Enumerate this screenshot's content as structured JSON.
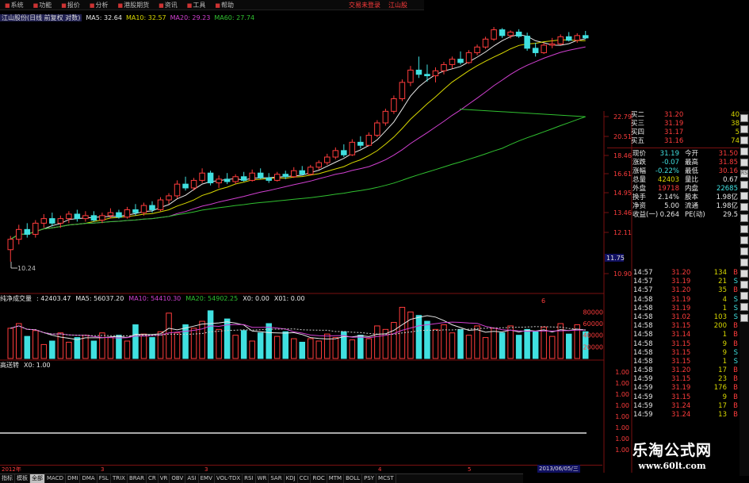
{
  "menu": {
    "items": [
      {
        "label": "系统",
        "icon": "menu-icon"
      },
      {
        "label": "功能",
        "icon": "menu-icon"
      },
      {
        "label": "报价",
        "icon": "menu-icon"
      },
      {
        "label": "分析",
        "icon": "menu-icon"
      },
      {
        "label": "港股期货",
        "icon": "menu-icon"
      },
      {
        "label": "资讯",
        "icon": "menu-icon"
      },
      {
        "label": "工具",
        "icon": "menu-icon"
      },
      {
        "label": "帮助",
        "icon": "menu-icon"
      }
    ],
    "right": [
      "交易未登录",
      "江山股"
    ]
  },
  "chart_header": {
    "stock_title": "江山股份(日线 前复权 对数)",
    "ma5": "MA5: 32.64",
    "ma10": "MA10: 32.57",
    "ma20": "MA20: 29.23",
    "ma60": "MA60: 27.74",
    "arrow": "↓"
  },
  "price_axis": {
    "labels": [
      "22.79",
      "20.51",
      "18.46",
      "16.61",
      "14.95",
      "13.46",
      "12.11",
      "10.90"
    ],
    "current": "11.75",
    "low_marker": "10.24"
  },
  "indicator1": {
    "name": "纯净成交量",
    "value": ": 42403.47",
    "ma5": "MA5: 56037.20",
    "ma10": "MA10: 54410.30",
    "ma20": "MA20: 54902.25",
    "x0": "X0: 0.00",
    "x01": "X01: 0.00",
    "axis": [
      "80000",
      "60000",
      "40000",
      "20000"
    ],
    "marker": "6"
  },
  "indicator2": {
    "name": "高送转",
    "x0": "X0: 1.00",
    "axis": [
      "1.00",
      "1.00",
      "1.00",
      "1.00",
      "1.00",
      "1.00",
      "1.00",
      "1.00"
    ]
  },
  "quote": {
    "bids": [
      {
        "label": "买二",
        "price": "31.20",
        "vol": "40"
      },
      {
        "label": "买三",
        "price": "31.19",
        "vol": "38"
      },
      {
        "label": "买四",
        "price": "31.17",
        "vol": "5"
      },
      {
        "label": "买五",
        "price": "31.16",
        "vol": "74"
      }
    ],
    "stats": [
      {
        "l1": "现价",
        "v1": "31.19",
        "l2": "今开",
        "v2": "31.50"
      },
      {
        "l1": "涨跌",
        "v1": "-0.07",
        "l2": "最高",
        "v2": "31.85"
      },
      {
        "l1": "涨幅",
        "v1": "-0.22%",
        "l2": "最低",
        "v2": "30.16"
      },
      {
        "l1": "总量",
        "v1": "42403",
        "l2": "量比",
        "v2": "0.67"
      },
      {
        "l1": "外盘",
        "v1": "19718",
        "l2": "内盘",
        "v2": "22685"
      },
      {
        "l1": "换手",
        "v1": "2.14%",
        "l2": "股本",
        "v2": "1.98亿"
      },
      {
        "l1": "净资",
        "v1": "5.00",
        "l2": "流通",
        "v2": "1.98亿"
      },
      {
        "l1": "收益(一)",
        "v1": "0.264",
        "l2": "PE(动)",
        "v2": "29.5"
      }
    ]
  },
  "ticks": [
    {
      "time": "14:57",
      "price": "31.20",
      "vol": "134",
      "flag": "B"
    },
    {
      "time": "14:57",
      "price": "31.19",
      "vol": "21",
      "flag": "S"
    },
    {
      "time": "14:57",
      "price": "31.20",
      "vol": "35",
      "flag": "B"
    },
    {
      "time": "14:58",
      "price": "31.19",
      "vol": "4",
      "flag": "S"
    },
    {
      "time": "14:58",
      "price": "31.19",
      "vol": "1",
      "flag": "S"
    },
    {
      "time": "14:58",
      "price": "31.02",
      "vol": "103",
      "flag": "S"
    },
    {
      "time": "14:58",
      "price": "31.15",
      "vol": "200",
      "flag": "B"
    },
    {
      "time": "14:58",
      "price": "31.14",
      "vol": "1",
      "flag": "B"
    },
    {
      "time": "14:58",
      "price": "31.15",
      "vol": "9",
      "flag": "B"
    },
    {
      "time": "14:58",
      "price": "31.15",
      "vol": "9",
      "flag": "S"
    },
    {
      "time": "14:58",
      "price": "31.15",
      "vol": "1",
      "flag": "S"
    },
    {
      "time": "14:58",
      "price": "31.20",
      "vol": "17",
      "flag": "B"
    },
    {
      "time": "14:59",
      "price": "31.15",
      "vol": "23",
      "flag": "B"
    },
    {
      "time": "14:59",
      "price": "31.19",
      "vol": "176",
      "flag": "B"
    },
    {
      "time": "14:59",
      "price": "31.15",
      "vol": "9",
      "flag": "B"
    },
    {
      "time": "14:59",
      "price": "31.24",
      "vol": "17",
      "flag": "B"
    },
    {
      "time": "14:59",
      "price": "31.24",
      "vol": "13",
      "flag": "B"
    }
  ],
  "time_axis": {
    "labels": [
      "2012年",
      "3",
      "3",
      "4",
      "5"
    ],
    "date": "2013/06/05/三"
  },
  "bottom_tabs": [
    "模板",
    "全部",
    "MACD",
    "DMI",
    "DMA",
    "FSL",
    "TRIX",
    "BRAR",
    "CR",
    "VR",
    "OBV",
    "ASI",
    "EMV",
    "VOL-TDX",
    "RSI",
    "WR",
    "SAR",
    "KDJ",
    "CCI",
    "ROC",
    "MTM",
    "BOLL",
    "PSY",
    "MCST"
  ],
  "bottom_left": "指标",
  "right_tools": [
    "rtool",
    "rtool",
    "rtool",
    "rtool",
    "rtool",
    "RSI",
    "rtool",
    "rtool",
    "rtool",
    "rtool",
    "rtool",
    "rtool",
    "rtool",
    "rtool",
    "rtool",
    "rtool",
    "rtool",
    "rtool",
    "rtool"
  ],
  "watermark": {
    "line1": "乐淘公式网",
    "line2": "www.60lt.com"
  },
  "colors": {
    "up": "#ff3c3c",
    "down": "#40e0e0",
    "ma5": "#e8e8e8",
    "ma10": "#d8d800",
    "ma20": "#d040d0",
    "ma60": "#30c030"
  },
  "chart_data": [
    {
      "type": "candlestick",
      "title": "江山股份(日线 前复权 对数)",
      "ylim": [
        10.24,
        34.5
      ],
      "ohlc": [
        [
          10.9,
          11.7,
          10.24,
          11.5
        ],
        [
          11.5,
          12.4,
          11.2,
          12.1
        ],
        [
          12.1,
          12.5,
          11.6,
          11.8
        ],
        [
          11.8,
          12.7,
          11.6,
          12.5
        ],
        [
          12.5,
          13.1,
          12.2,
          12.8
        ],
        [
          12.8,
          13.2,
          12.3,
          12.5
        ],
        [
          12.5,
          13.0,
          12.2,
          12.8
        ],
        [
          12.8,
          13.3,
          12.5,
          13.1
        ],
        [
          13.1,
          13.4,
          12.6,
          12.8
        ],
        [
          12.8,
          13.3,
          12.6,
          13.0
        ],
        [
          13.0,
          13.3,
          12.6,
          12.7
        ],
        [
          12.7,
          13.2,
          12.5,
          13.0
        ],
        [
          13.0,
          13.5,
          12.8,
          13.2
        ],
        [
          13.2,
          13.4,
          12.8,
          12.9
        ],
        [
          12.9,
          13.6,
          12.8,
          13.4
        ],
        [
          13.4,
          13.8,
          13.0,
          13.2
        ],
        [
          13.2,
          13.9,
          13.0,
          13.7
        ],
        [
          13.7,
          14.0,
          13.2,
          13.4
        ],
        [
          13.4,
          14.3,
          13.3,
          14.1
        ],
        [
          14.1,
          14.6,
          13.8,
          14.4
        ],
        [
          14.4,
          15.6,
          14.2,
          15.3
        ],
        [
          15.3,
          15.9,
          14.8,
          15.0
        ],
        [
          15.0,
          15.8,
          14.8,
          15.6
        ],
        [
          15.6,
          16.6,
          15.4,
          16.2
        ],
        [
          16.2,
          16.4,
          15.2,
          15.4
        ],
        [
          15.4,
          16.0,
          15.0,
          15.7
        ],
        [
          15.7,
          16.2,
          15.3,
          15.5
        ],
        [
          15.5,
          16.1,
          15.3,
          15.9
        ],
        [
          15.9,
          16.3,
          15.5,
          15.6
        ],
        [
          15.6,
          16.5,
          15.5,
          16.2
        ],
        [
          16.2,
          16.6,
          15.7,
          15.8
        ],
        [
          15.8,
          16.2,
          15.4,
          15.6
        ],
        [
          15.6,
          16.3,
          15.5,
          16.1
        ],
        [
          16.1,
          16.4,
          15.7,
          15.9
        ],
        [
          15.9,
          16.7,
          15.8,
          16.4
        ],
        [
          16.4,
          16.8,
          16.0,
          16.1
        ],
        [
          16.1,
          16.9,
          16.0,
          16.7
        ],
        [
          16.7,
          17.3,
          16.5,
          17.1
        ],
        [
          17.1,
          17.9,
          16.9,
          17.6
        ],
        [
          17.6,
          18.5,
          17.4,
          18.2
        ],
        [
          18.2,
          18.8,
          17.6,
          17.8
        ],
        [
          17.8,
          19.3,
          17.7,
          19.0
        ],
        [
          19.0,
          19.6,
          18.4,
          18.7
        ],
        [
          18.7,
          20.0,
          18.6,
          19.7
        ],
        [
          19.7,
          21.3,
          19.5,
          21.0
        ],
        [
          21.0,
          22.6,
          20.7,
          22.3
        ],
        [
          22.3,
          24.2,
          22.0,
          23.8
        ],
        [
          23.8,
          26.3,
          23.5,
          25.9
        ],
        [
          25.9,
          28.2,
          25.4,
          27.6
        ],
        [
          27.6,
          29.6,
          26.5,
          27.0
        ],
        [
          27.0,
          28.4,
          26.0,
          26.8
        ],
        [
          26.8,
          28.0,
          25.9,
          27.5
        ],
        [
          27.5,
          28.8,
          27.0,
          28.4
        ],
        [
          28.4,
          29.6,
          27.8,
          29.2
        ],
        [
          29.2,
          30.4,
          28.4,
          28.7
        ],
        [
          28.7,
          30.6,
          28.5,
          30.2
        ],
        [
          30.2,
          31.5,
          29.8,
          31.1
        ],
        [
          31.1,
          32.8,
          30.8,
          32.4
        ],
        [
          32.4,
          34.5,
          32.1,
          34.0
        ],
        [
          34.0,
          34.3,
          32.6,
          33.0
        ],
        [
          33.0,
          33.9,
          32.5,
          33.6
        ],
        [
          33.6,
          34.1,
          32.6,
          32.9
        ],
        [
          32.9,
          33.5,
          30.5,
          30.9
        ],
        [
          30.9,
          31.8,
          29.6,
          30.2
        ],
        [
          30.2,
          31.8,
          30.0,
          31.4
        ],
        [
          31.4,
          32.6,
          30.9,
          31.6
        ],
        [
          31.6,
          33.2,
          31.4,
          32.8
        ],
        [
          32.8,
          33.6,
          32.0,
          32.2
        ],
        [
          32.2,
          33.4,
          31.8,
          33.0
        ],
        [
          33.0,
          33.8,
          32.4,
          32.6
        ]
      ],
      "volume": [
        52000,
        60000,
        38000,
        48000,
        24000,
        30000,
        44000,
        28000,
        36000,
        40000,
        30000,
        44000,
        36000,
        40000,
        30000,
        58000,
        42000,
        36000,
        46000,
        78000,
        44000,
        58000,
        52000,
        64000,
        82000,
        50000,
        68000,
        40000,
        48000,
        30000,
        44000,
        60000,
        38000,
        46000,
        34000,
        28000,
        34000,
        30000,
        42000,
        36000,
        46000,
        32000,
        40000,
        34000,
        56000,
        50000,
        62000,
        88000,
        80000,
        74000,
        64000,
        50000,
        58000,
        44000,
        50000,
        40000,
        56000,
        36000,
        52000,
        44000,
        56000,
        40000,
        50000,
        46000,
        54000,
        38000,
        60000,
        42000,
        58000,
        46000
      ]
    }
  ]
}
